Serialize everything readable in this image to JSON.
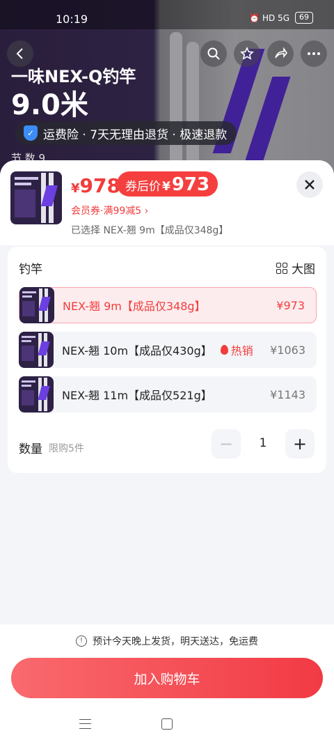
{
  "status": {
    "time": "10:19",
    "icons": "⏰ HD 5G",
    "battery": "69"
  },
  "background": {
    "title": "一味NEX-Q钓竿",
    "subtitle": "9.0米",
    "promise": "运费险 · 7天无理由退货 · 极速退款",
    "spec": "节          数      9"
  },
  "sheet": {
    "price": {
      "currency": "¥",
      "value": "978"
    },
    "coupon_price": {
      "label": "券后价",
      "currency": "¥",
      "value": "973"
    },
    "member_coupon": "会员券·满99减5 ›",
    "selected_text": "已选择 NEX-翘 9m【成品仅348g】",
    "section_title": "钓竿",
    "big_view": "大图",
    "options": [
      {
        "name": "NEX-翘 9m【成品仅348g】",
        "price": "¥973",
        "selected": true,
        "hot": ""
      },
      {
        "name": "NEX-翘 10m【成品仅430g】",
        "price": "¥1063",
        "selected": false,
        "hot": "热销"
      },
      {
        "name": "NEX-翘 11m【成品仅521g】",
        "price": "¥1143",
        "selected": false,
        "hot": ""
      }
    ],
    "quantity": {
      "label": "数量",
      "limit": "限购5件",
      "value": "1",
      "minus": "−",
      "plus": "+"
    },
    "delivery": "预计今天晚上发货，明天送达，免运费",
    "add_to_cart": "加入购物车"
  },
  "colors": {
    "accent": "#f23c3c",
    "sheet_bg": "#f4f5f9"
  }
}
